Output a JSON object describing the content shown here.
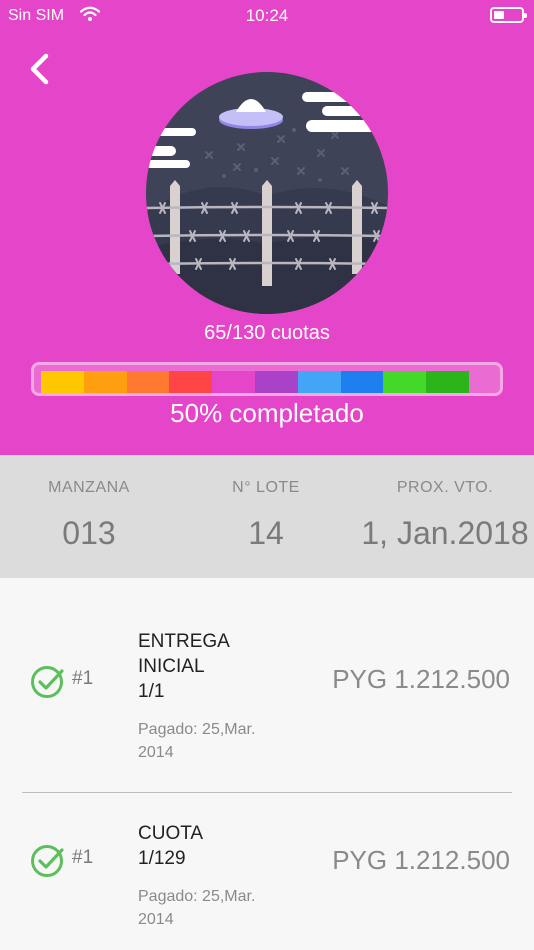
{
  "status_bar": {
    "carrier": "Sin SIM",
    "time": "10:24"
  },
  "progress": {
    "cuotas_label": "65/130 cuotas",
    "completed_fraction": 0.5,
    "completed_label": "50% completado",
    "segment_colors": [
      "#ffc700",
      "#ff9f10",
      "#ff7a30",
      "#ff4545",
      "#e545c8",
      "#a942c8",
      "#42a5f5",
      "#1e7ff0",
      "#44d82a",
      "#2cb51a"
    ]
  },
  "summary": {
    "manzana_label": "MANZANA",
    "manzana_value": "013",
    "lote_label": "N° LOTE",
    "lote_value": "14",
    "vto_label": "PROX. VTO.",
    "vto_value": "1, Jan.2018"
  },
  "payments": [
    {
      "number": "#1",
      "concept_line1": "ENTREGA",
      "concept_line2": "INICIAL",
      "concept_line3": "1/1",
      "paid_line1": "Pagado: 25,Mar.",
      "paid_line2": "2014",
      "amount": "PYG 1.212.500"
    },
    {
      "number": "#1",
      "concept_line1": "CUOTA",
      "concept_line2": "1/129",
      "paid_line1": "Pagado: 25,Mar.",
      "paid_line2": "2014",
      "amount": "PYG 1.212.500"
    }
  ],
  "colors": {
    "accent": "#e545c8",
    "check_green": "#5cbf5c"
  }
}
